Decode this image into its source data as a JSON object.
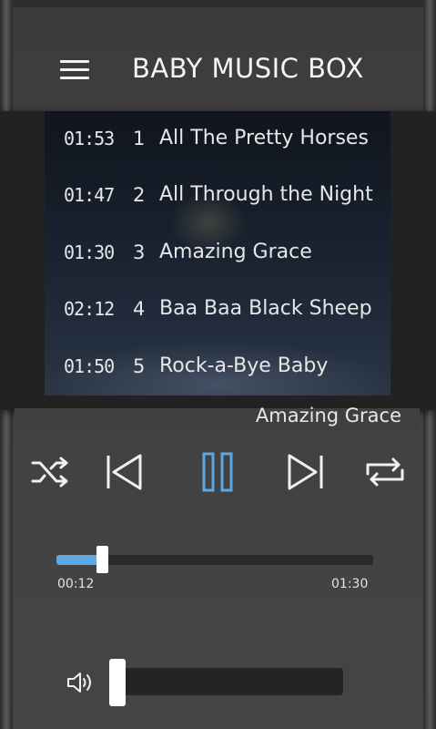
{
  "app": {
    "title": "BABY MUSIC BOX"
  },
  "playlist": [
    {
      "duration": "01:53",
      "number": "1",
      "title": "All The Pretty Horses"
    },
    {
      "duration": "01:47",
      "number": "2",
      "title": "All Through the Night"
    },
    {
      "duration": "01:30",
      "number": "3",
      "title": "Amazing Grace"
    },
    {
      "duration": "02:12",
      "number": "4",
      "title": "Baa Baa Black Sheep"
    },
    {
      "duration": "01:50",
      "number": "5",
      "title": "Rock-a-Bye Baby"
    }
  ],
  "now_playing": {
    "title": "Amazing Grace"
  },
  "player": {
    "elapsed": "00:12",
    "total": "01:30",
    "progress_fraction": 0.133,
    "volume_fraction": 0.0,
    "state": "playing",
    "accent_color": "#5aa8e6"
  },
  "icons": {
    "menu": "hamburger-menu-icon",
    "shuffle": "shuffle-icon",
    "previous": "skip-previous-icon",
    "pause": "pause-icon",
    "next": "skip-next-icon",
    "repeat": "repeat-icon",
    "volume": "speaker-volume-icon"
  }
}
